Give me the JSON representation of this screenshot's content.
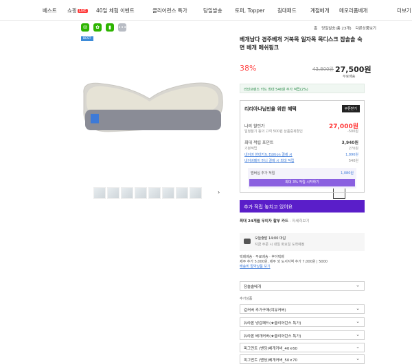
{
  "nav": {
    "items": [
      "베스트",
      "쇼핑",
      "40일 체험 이벤트",
      "클리어런스 특가",
      "당일발송",
      "토퍼, Topper",
      "침대패드",
      "계절베개",
      "메모리폼베개",
      "더보기"
    ],
    "live_badge": "LIVE"
  },
  "share_icons": [
    "chat-icon",
    "gift-icon",
    "bookmark-icon",
    "more-icon"
  ],
  "breadcrumb": [
    "홈",
    "당일발송(총 23개)",
    "다른상품보기"
  ],
  "badge": "BEST",
  "product": {
    "title": "베개남다 경주베개 거북목 일자목 목디스크 잠솔솔 숙면 베개 메쉬핑크",
    "discount": "38%",
    "original_price": "43,800원",
    "price": "27,500원",
    "shipping": "무료배송"
  },
  "promo": "라인프렌즈 카드 최대 540원 추가 적립(2%)",
  "benefit": {
    "title": "리리아나님만을 위한 혜택",
    "coupon_button": "쿠폰받기",
    "my_price_label": "나의 할인가",
    "my_price": "27,000원",
    "sub_label": "일정분기 동의 고객 500원 상품중복할인",
    "sub_value": "-500원",
    "point_label": "최대 적립 포인트",
    "point_value": "3,940원",
    "rows": [
      {
        "label": "기본적립",
        "value": "270원"
      },
      {
        "label": "네이버 현대카드 Edition 결제 시",
        "value": "1,890원"
      },
      {
        "label": "네이버페이 머니 결제 시 최대 적립",
        "value": "540원"
      }
    ],
    "membership_label": "멤버십 추가 적립",
    "membership_value": "1,080원",
    "membership_button": "최대 3% 적립 시작하기"
  },
  "naver_banner": "추가 적립 놓치고 있어요",
  "card_info": "최대 24개월 무이자 할부 카드",
  "card_link": "자세히보기",
  "delivery": {
    "line1": "오늘출발 14:00 마감",
    "line2": "지금 주문 시 내일 화요일 도착예정",
    "info1": "택배배송 · 무료배송 · 후아택배",
    "info2": "제주 추가 5,000원, 제주 외 도서지역 추가 7,000원 | 5000",
    "info3": "배송비 절약상품 보기"
  },
  "options": {
    "main": "잠솔솔베개",
    "extra_label": "추가상품",
    "items": [
      "겉커버 추가구매(여유커버)",
      "듀라론 냉감패드(★클리어런스 특가)",
      "듀라론 베개커버(★클리어런스 특가)",
      "피그먼트 (밴딩)베개커버_40×60",
      "피그먼트 (밴딩)베개커버_50×70"
    ]
  }
}
